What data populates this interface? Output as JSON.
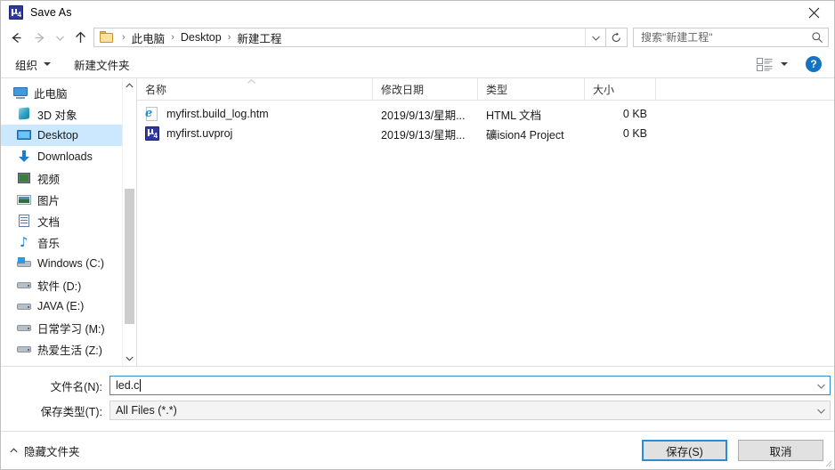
{
  "window": {
    "title": "Save As",
    "icon": "uvision-icon",
    "close_label": "close-icon"
  },
  "nav": {
    "back": "back-arrow-icon",
    "forward": "forward-arrow-icon",
    "recent": "recent-locations-chevron-icon",
    "up": "up-arrow-icon",
    "breadcrumbs": [
      "此电脑",
      "Desktop",
      "新建工程"
    ],
    "separator": "›",
    "address_dropdown": "chevron-down-icon",
    "refresh": "refresh-icon"
  },
  "search": {
    "placeholder": "搜索\"新建工程\"",
    "value": "",
    "icon": "search-icon"
  },
  "command_bar": {
    "organize_label": "组织",
    "new_folder_label": "新建文件夹",
    "view_icon": "list-view-icon",
    "view_dropdown": "chevron-down-icon",
    "help_label": "?"
  },
  "sidebar": {
    "items": [
      {
        "label": "此电脑",
        "icon": "pc-icon",
        "selected": false,
        "root": true
      },
      {
        "label": "3D 对象",
        "icon": "3d-objects-icon",
        "selected": false,
        "root": false
      },
      {
        "label": "Desktop",
        "icon": "desktop-icon",
        "selected": true,
        "root": false
      },
      {
        "label": "Downloads",
        "icon": "downloads-icon",
        "selected": false,
        "root": false
      },
      {
        "label": "视频",
        "icon": "videos-icon",
        "selected": false,
        "root": false
      },
      {
        "label": "图片",
        "icon": "pictures-icon",
        "selected": false,
        "root": false
      },
      {
        "label": "文档",
        "icon": "documents-icon",
        "selected": false,
        "root": false
      },
      {
        "label": "音乐",
        "icon": "music-icon",
        "selected": false,
        "root": false
      },
      {
        "label": "Windows (C:)",
        "icon": "windows-drive-icon",
        "selected": false,
        "root": false
      },
      {
        "label": "软件 (D:)",
        "icon": "drive-icon",
        "selected": false,
        "root": false
      },
      {
        "label": "JAVA (E:)",
        "icon": "drive-icon",
        "selected": false,
        "root": false
      },
      {
        "label": "日常学习 (M:)",
        "icon": "drive-icon",
        "selected": false,
        "root": false
      },
      {
        "label": "热爱生活 (Z:)",
        "icon": "drive-icon",
        "selected": false,
        "root": false
      }
    ],
    "scrollbar": {
      "up_icon": "chevron-up-icon",
      "down_icon": "chevron-down-icon"
    }
  },
  "file_list": {
    "columns": [
      "名称",
      "修改日期",
      "类型",
      "大小"
    ],
    "sort_indicator": "sort-ascending-icon",
    "rows": [
      {
        "name": "myfirst.build_log.htm",
        "date": "2019/9/13/星期...",
        "type": "HTML 文档",
        "size": "0 KB",
        "icon": "html-file-icon"
      },
      {
        "name": "myfirst.uvproj",
        "date": "2019/9/13/星期...",
        "type": "礦ision4 Project",
        "size": "0 KB",
        "icon": "uvision-file-icon"
      }
    ]
  },
  "form": {
    "filename_label": "文件名(N):",
    "filename_value": "led.c",
    "filetype_label": "保存类型(T):",
    "filetype_value": "All Files (*.*)",
    "dropdown_icon": "chevron-down-icon"
  },
  "footer": {
    "hide_folders_label": "隐藏文件夹",
    "hide_folders_icon": "chevron-up-icon",
    "save_label": "保存(S)",
    "cancel_label": "取消",
    "resize_grip": "resize-grip-icon"
  },
  "colors": {
    "accent": "#2a8dd4",
    "selection": "#cce8ff",
    "help_blue": "#1673c4",
    "folder_yellow": "#fbe2a0"
  }
}
